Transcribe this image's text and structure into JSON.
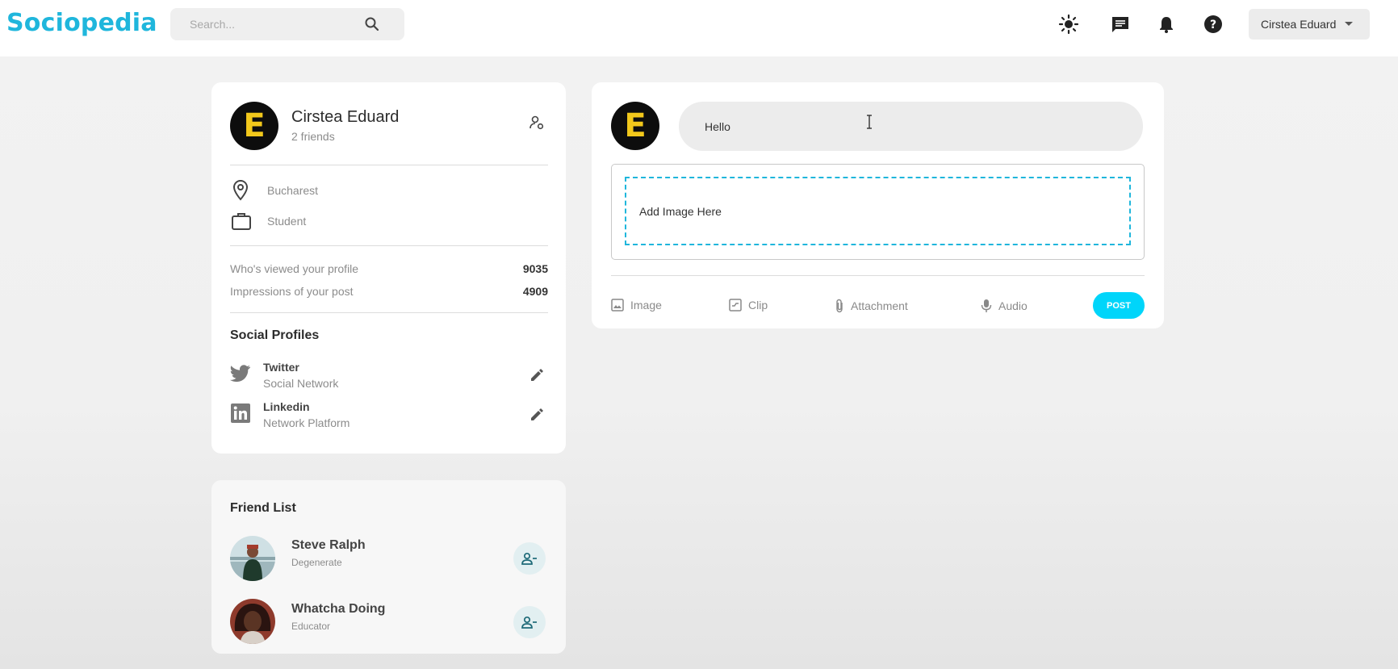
{
  "brand": {
    "name": "Sociopedia",
    "accent": "#1fb6dc"
  },
  "search": {
    "placeholder": "Search...",
    "icon": "search-icon"
  },
  "nav": {
    "icons": [
      "light-mode-icon",
      "message-icon",
      "notification-bell-icon",
      "help-icon"
    ],
    "user_name": "Cirstea Eduard"
  },
  "profile": {
    "avatar_letter": "E",
    "name": "Cirstea Eduard",
    "friends": "2 friends",
    "location": "Bucharest",
    "occupation": "Student",
    "stats": [
      {
        "label": "Who's viewed your profile",
        "value": "9035"
      },
      {
        "label": "Impressions of your post",
        "value": "4909"
      }
    ],
    "social_title": "Social Profiles",
    "social": [
      {
        "name": "Twitter",
        "desc": "Social Network"
      },
      {
        "name": "Linkedin",
        "desc": "Network Platform"
      }
    ]
  },
  "post": {
    "avatar_letter": "E",
    "input_value": "Hello",
    "dropzone_text": "Add Image Here",
    "actions": [
      "Image",
      "Clip",
      "Attachment",
      "Audio"
    ],
    "submit": "POST",
    "submit_color": "#00d5fa"
  },
  "friends": {
    "title": "Friend List",
    "items": [
      {
        "name": "Steve Ralph",
        "occupation": "Degenerate"
      },
      {
        "name": "Whatcha Doing",
        "occupation": "Educator"
      }
    ]
  }
}
